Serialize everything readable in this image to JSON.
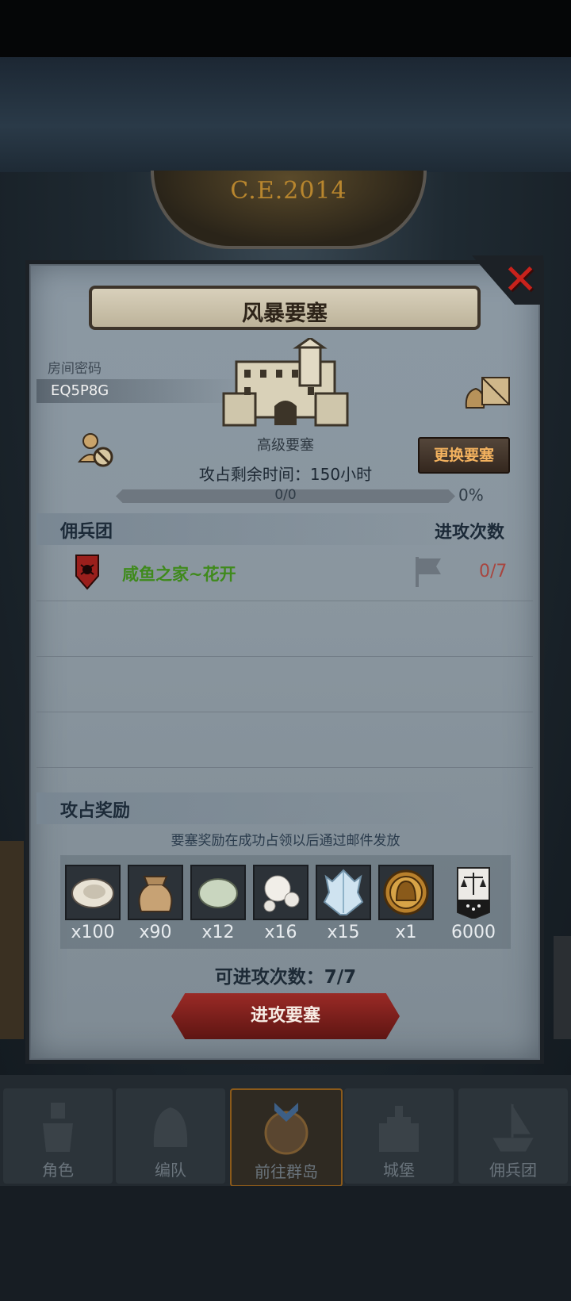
{
  "header": {
    "emblem_text": "C.E.2014"
  },
  "dialog": {
    "title": "风暴要塞",
    "room_code_label": "房间密码",
    "room_code": "EQ5P8G",
    "fortress_name": "高级要塞",
    "change_button": "更换要塞",
    "time_label": "攻占剩余时间：150小时",
    "progress": {
      "text": "0/0",
      "percent": "0%",
      "fraction": 0
    }
  },
  "mercenary": {
    "section_title": "佣兵团",
    "attack_count_title": "进攻次数",
    "rows": [
      {
        "name": "咸鱼之家~花开",
        "count": "0/7"
      }
    ]
  },
  "rewards": {
    "section_title": "攻占奖励",
    "note": "要塞奖励在成功占领以后通过邮件发放",
    "items": [
      {
        "icon": "oyster-icon",
        "qty": "x100"
      },
      {
        "icon": "pouch-icon",
        "qty": "x90"
      },
      {
        "icon": "jade-stone-icon",
        "qty": "x12"
      },
      {
        "icon": "pearl-icon",
        "qty": "x16"
      },
      {
        "icon": "ice-crystal-icon",
        "qty": "x15"
      },
      {
        "icon": "gold-helmet-coin-icon",
        "qty": "x1"
      },
      {
        "icon": "justice-banner-icon",
        "qty": "6000"
      }
    ]
  },
  "remaining_attacks": "可进攻次数：7/7",
  "attack_button": "进攻要塞",
  "tabs": [
    {
      "label": "角色",
      "icon": "knight-icon"
    },
    {
      "label": "编队",
      "icon": "helmet-icon"
    },
    {
      "label": "前往群岛",
      "icon": "island-compass-icon"
    },
    {
      "label": "城堡",
      "icon": "castle-icon"
    },
    {
      "label": "佣兵团",
      "icon": "ship-icon"
    }
  ],
  "colors": {
    "guild_name": "#3f8a1c",
    "attack_count": "#a8453f",
    "change_button_text": "#f3b25f",
    "close": "#c8221c"
  }
}
